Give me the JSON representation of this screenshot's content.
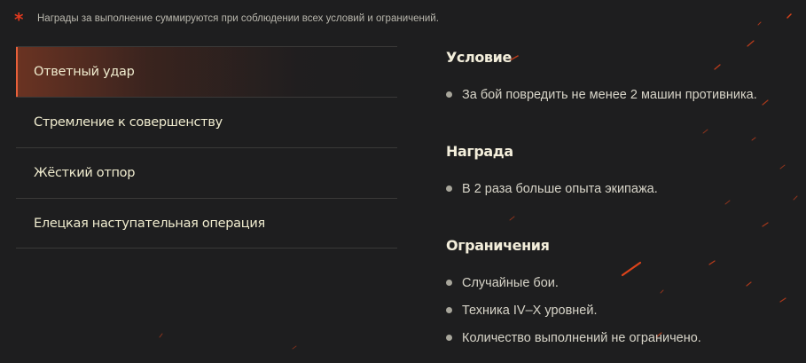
{
  "note": {
    "star": "*",
    "text": "Награды за выполнение суммируются при соблюдении всех условий и ограничений."
  },
  "menu": {
    "items": [
      {
        "label": "Ответный удар",
        "active": true
      },
      {
        "label": "Стремление к совершенству",
        "active": false
      },
      {
        "label": "Жёсткий отпор",
        "active": false
      },
      {
        "label": "Елецкая наступательная операция",
        "active": false
      }
    ]
  },
  "details": {
    "condition": {
      "title": "Условие",
      "items": [
        "За бой повредить не менее 2 машин противника."
      ]
    },
    "reward": {
      "title": "Награда",
      "items": [
        "В 2 раза больше опыта экипажа."
      ]
    },
    "limits": {
      "title": "Ограничения",
      "items": [
        "Случайные бои.",
        "Техника IV–X уровней.",
        "Количество выполнений не ограничено."
      ]
    }
  },
  "colors": {
    "background": "#1e1e1f",
    "accent": "#e8603a",
    "star": "#e0391e",
    "text_primary": "#f0eccf",
    "text_secondary": "#d7d4c8"
  }
}
